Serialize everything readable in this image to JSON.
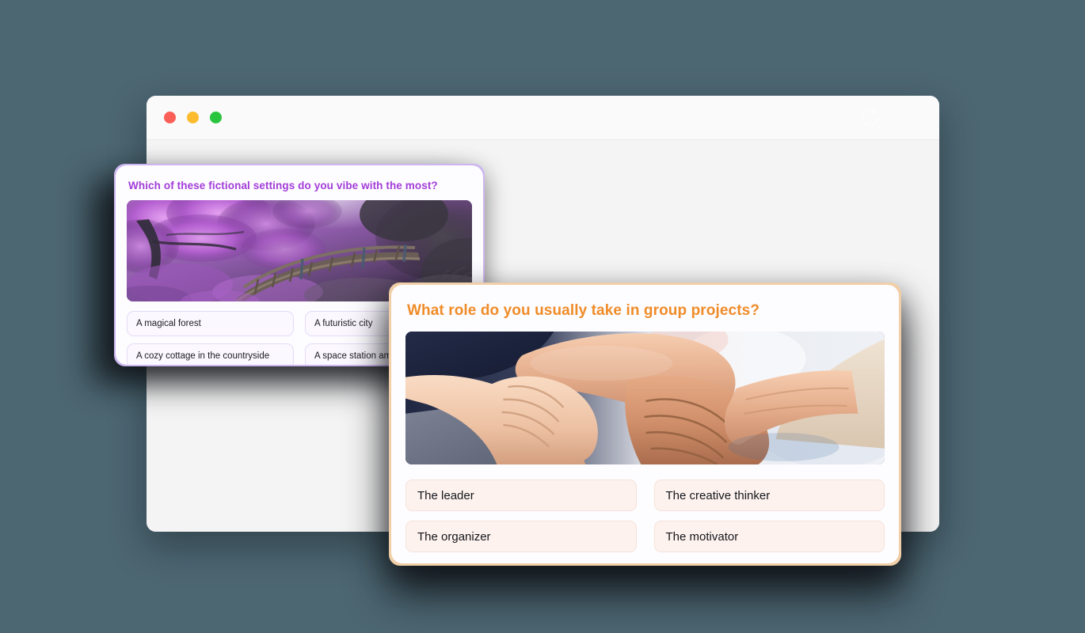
{
  "background_color": "#4c6672",
  "browser": {
    "name": "browser-window",
    "body_color": "#f4f4f4",
    "chrome_color": "#fafafa",
    "traffic_lights": [
      {
        "name": "close",
        "color": "#fb5f57"
      },
      {
        "name": "minimize",
        "color": "#fcbc2e"
      },
      {
        "name": "maximize",
        "color": "#29c53f"
      }
    ],
    "refresh_icon": "refresh-icon"
  },
  "cards": [
    {
      "id": "quiz-card-fictional-settings",
      "title": "Which of these fictional settings do you vibe with the most?",
      "accent_color": "#a23dd8",
      "border_color": "#cdb6f0",
      "option_bg": "#fbf8ff",
      "option_border": "#e5dbf7",
      "image_alt": "purple-forest-bridge",
      "options": [
        "A magical forest",
        "A futuristic city",
        "A cozy cottage in the countryside",
        "A space station among the stars"
      ]
    },
    {
      "id": "quiz-card-group-role",
      "title": "What role do you usually take in group projects?",
      "accent_color": "#ef8c28",
      "border_color": "#f0cfa8",
      "option_bg": "#fdf2ee",
      "option_border": "#f6e2d9",
      "image_alt": "hands-gripping-wrists-teamwork",
      "options": [
        "The leader",
        "The creative thinker",
        "The organizer",
        "The motivator"
      ]
    }
  ]
}
